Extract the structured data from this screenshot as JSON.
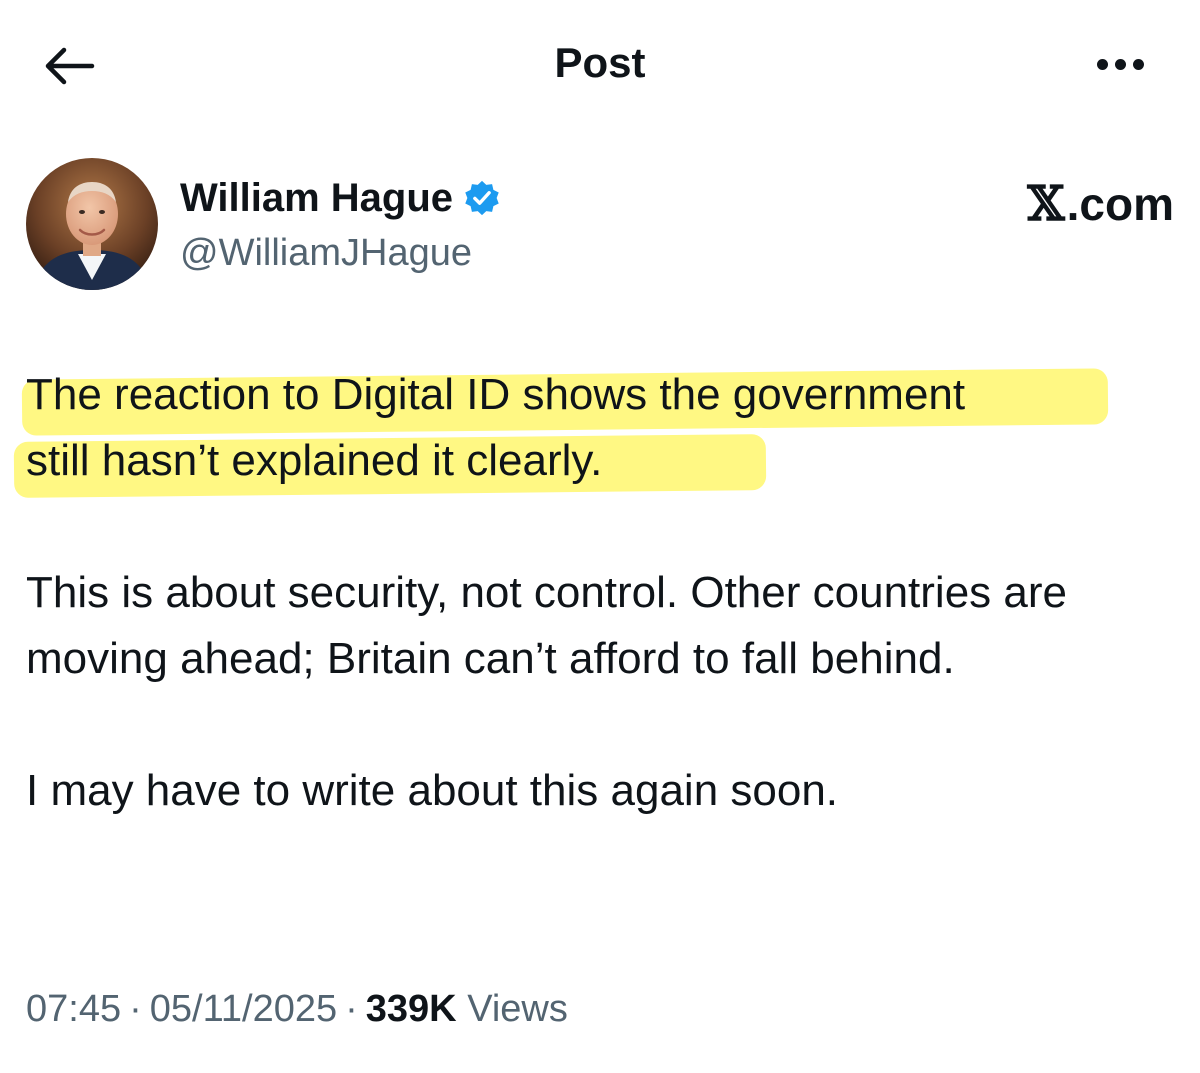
{
  "header": {
    "title": "Post",
    "back_icon": "arrow-left-icon",
    "more_icon": "more-horizontal-icon"
  },
  "author": {
    "display_name": "William Hague",
    "handle": "@WilliamJHague",
    "verified": true,
    "verified_color": "#1d9bf0"
  },
  "source": {
    "label": ".com",
    "logo_glyph": "𝕏"
  },
  "tweet": {
    "highlighted_lines": [
      "The reaction to Digital ID shows the government",
      "still hasn’t explained it clearly."
    ],
    "highlight_color": "#fff55a",
    "paragraph_2": "This is about security, not control. Other countries are moving ahead; Britain can’t afford to fall behind.",
    "paragraph_3": "I may have to write about this again soon."
  },
  "meta": {
    "time": "07:45",
    "date": "05/11/2025",
    "separator": "·",
    "views_count": "339K",
    "views_label": "Views"
  },
  "colors": {
    "text": "#0f1419",
    "secondary": "#536471"
  }
}
